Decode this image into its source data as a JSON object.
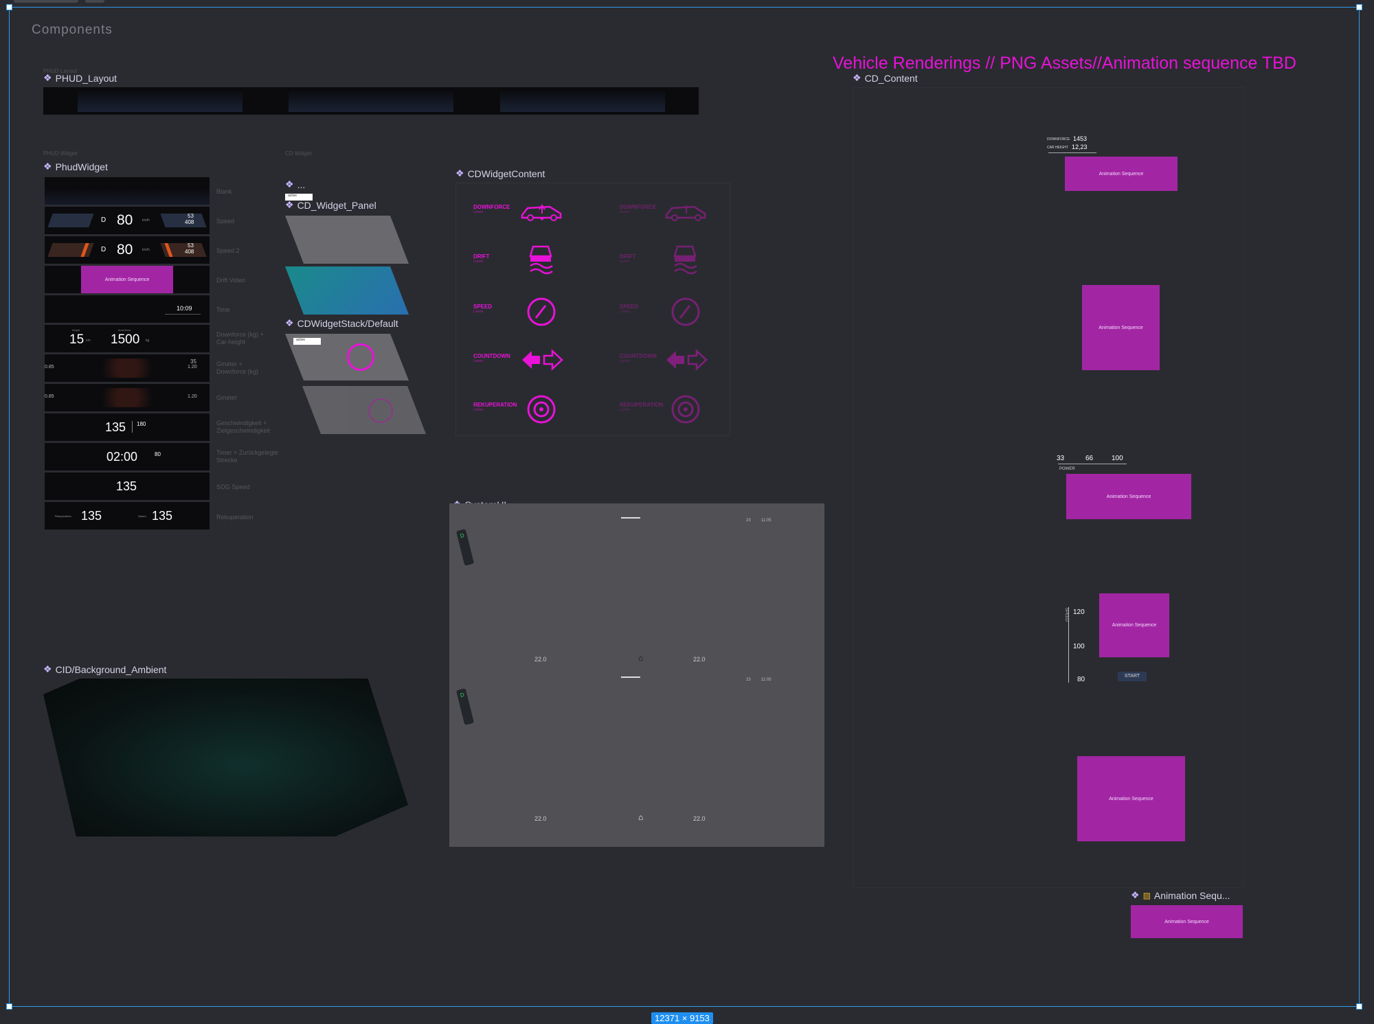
{
  "page": {
    "title": "Components",
    "size_badge": "12371 × 9153"
  },
  "annotation": {
    "text": "Vehicle Renderings // PNG Assets//Animation sequence TBD"
  },
  "components": {
    "phud_layout": {
      "ghost": "PHUD Layout",
      "label": "PHUD_Layout"
    },
    "phud_widget": {
      "ghost": "PHUD Widget",
      "label": "PhudWidget"
    },
    "cd_widget_ghost": "CD Widget",
    "cd_widget_content": {
      "label": "CDWidgetContent"
    },
    "cd_widget_dots": "...",
    "cd_widget_panel": {
      "label": "CD_Widget_Panel",
      "badge": "active"
    },
    "cd_widget_stack": {
      "label": "CDWidgetStack/Default",
      "badge": "active"
    },
    "system_ui": {
      "label": "SystemUI"
    },
    "background_ambient": {
      "label": "CID/Background_Ambient"
    },
    "cd_content": {
      "label": "CD_Content"
    },
    "animation_seq": {
      "label": "Animation Sequ...",
      "tile_text": "Animation Sequence"
    }
  },
  "phud_rows": [
    {
      "label": "Blank"
    },
    {
      "label": "Speed",
      "gear": "D",
      "speed": "80",
      "unit": "km/h",
      "r1": "53",
      "r2": "408"
    },
    {
      "label": "Speed 2",
      "gear": "D",
      "speed": "80",
      "unit": "km/h",
      "r1": "53",
      "r2": "408"
    },
    {
      "label": "Drift Video",
      "seq": "Animation Sequence"
    },
    {
      "label": "Time",
      "time": "10:09"
    },
    {
      "label": "Downforce (kg) + Car-height",
      "a": "15",
      "a_unit": "cm",
      "b": "1500",
      "b_unit": "kg",
      "a_cap": "height",
      "b_cap": "downforce"
    },
    {
      "label": "Gmeter + Downforce (kg)",
      "left": "0.85",
      "right": "1.20",
      "top": "35"
    },
    {
      "label": "Gmeter",
      "left": "0.85",
      "right": "1.20"
    },
    {
      "label": "Geschwindigkeit + Zielgeschwindigkeit",
      "speed": "135",
      "target": "180"
    },
    {
      "label": "Timer + Zurückgelegte Strecke",
      "time": "02:00",
      "dist": "80"
    },
    {
      "label": "SOG Speed",
      "speed": "135"
    },
    {
      "label": "Rekuperation",
      "a": "135",
      "b": "135",
      "a_cap": "Rekuperation",
      "b_cap": "Speed"
    }
  ],
  "cd_widgets": [
    {
      "title": "DOWNFORCE",
      "sub": "Lorem",
      "icon": "car-downforce-icon"
    },
    {
      "title": "DRIFT",
      "sub": "Lorem",
      "icon": "drift-car-icon"
    },
    {
      "title": "SPEED",
      "sub": "Lorem",
      "icon": "speedometer-icon"
    },
    {
      "title": "COUNTDOWN",
      "sub": "Lorem",
      "icon": "arrows-icon"
    },
    {
      "title": "REKUPERATION",
      "sub": "Lorem",
      "icon": "wheel-icon"
    }
  ],
  "system_ui": {
    "date1": "23",
    "time1": "11:05",
    "temp_left": "22.0",
    "temp_right": "22.0",
    "date2": "23",
    "time2": "11:05"
  },
  "cd_content": {
    "downforce_label": "DOWNFORCE",
    "downforce_val": "1453",
    "carheight_label": "CAR HEIGHT",
    "carheight_val": "12,23",
    "power_vals": [
      "33",
      "66",
      "100"
    ],
    "power_label": "POWER",
    "speed_label": "SPEED",
    "speed_vals": [
      "120",
      "100",
      "80"
    ],
    "start_label": "START",
    "seq_text": "Animation Sequence"
  },
  "colors": {
    "accent": "#e812d8",
    "frame": "#2f9bf0",
    "bg": "#2a2b30",
    "seq_tile": "#a226a4"
  }
}
